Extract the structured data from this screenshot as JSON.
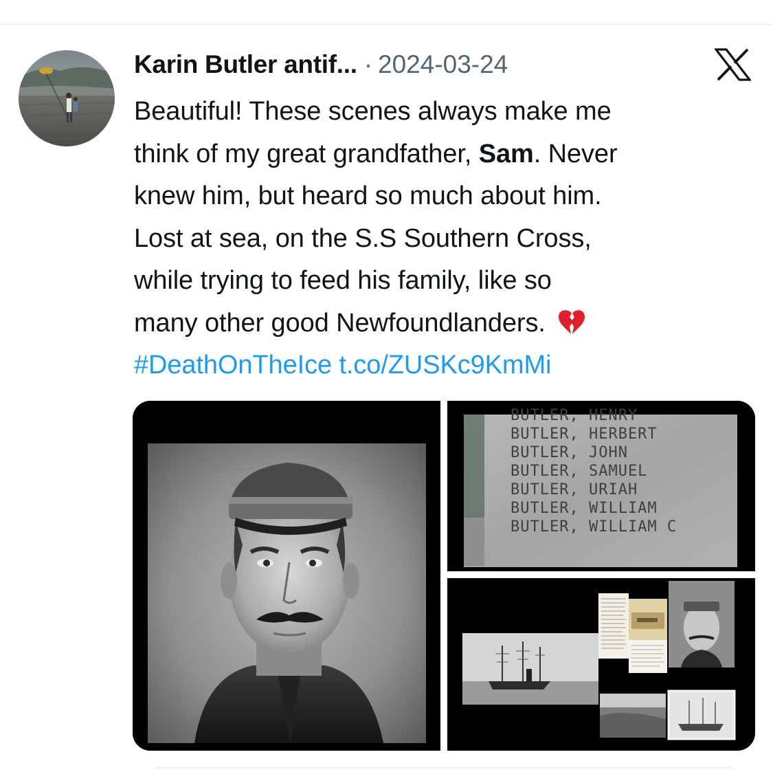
{
  "post": {
    "author_name": "Karin Butler antif...",
    "separator": "·",
    "date": "2024-03-24",
    "body": {
      "line1": "Beautiful! These scenes always make me",
      "line2_pre": "think of my great grandfather, ",
      "line2_bold": "Sam",
      "line2_post": ". Never",
      "line3": "knew him, but heard so much about him.",
      "line4": "Lost at sea, on the S.S Southern Cross,",
      "line5": "while trying to feed his family, like so",
      "line6": "many other good Newfoundlanders. ",
      "hashtag": "#DeathOnTheIce",
      "url": "t.co/ZUSKc9KmMi"
    },
    "emoji_icon": "broken-heart-icon",
    "platform_icon": "x-logo-icon"
  },
  "media": {
    "memorial_names": [
      "BUTLER, HENRY",
      "BUTLER, HERBERT",
      "BUTLER, JOHN",
      "BUTLER, SAMUEL",
      "BUTLER, URIAH",
      "BUTLER, WILLIAM",
      "BUTLER, WILLIAM C"
    ]
  },
  "colors": {
    "text": "#0f1419",
    "secondary": "#536471",
    "link": "#1d9bf0",
    "broken_heart": "#e0202a"
  }
}
